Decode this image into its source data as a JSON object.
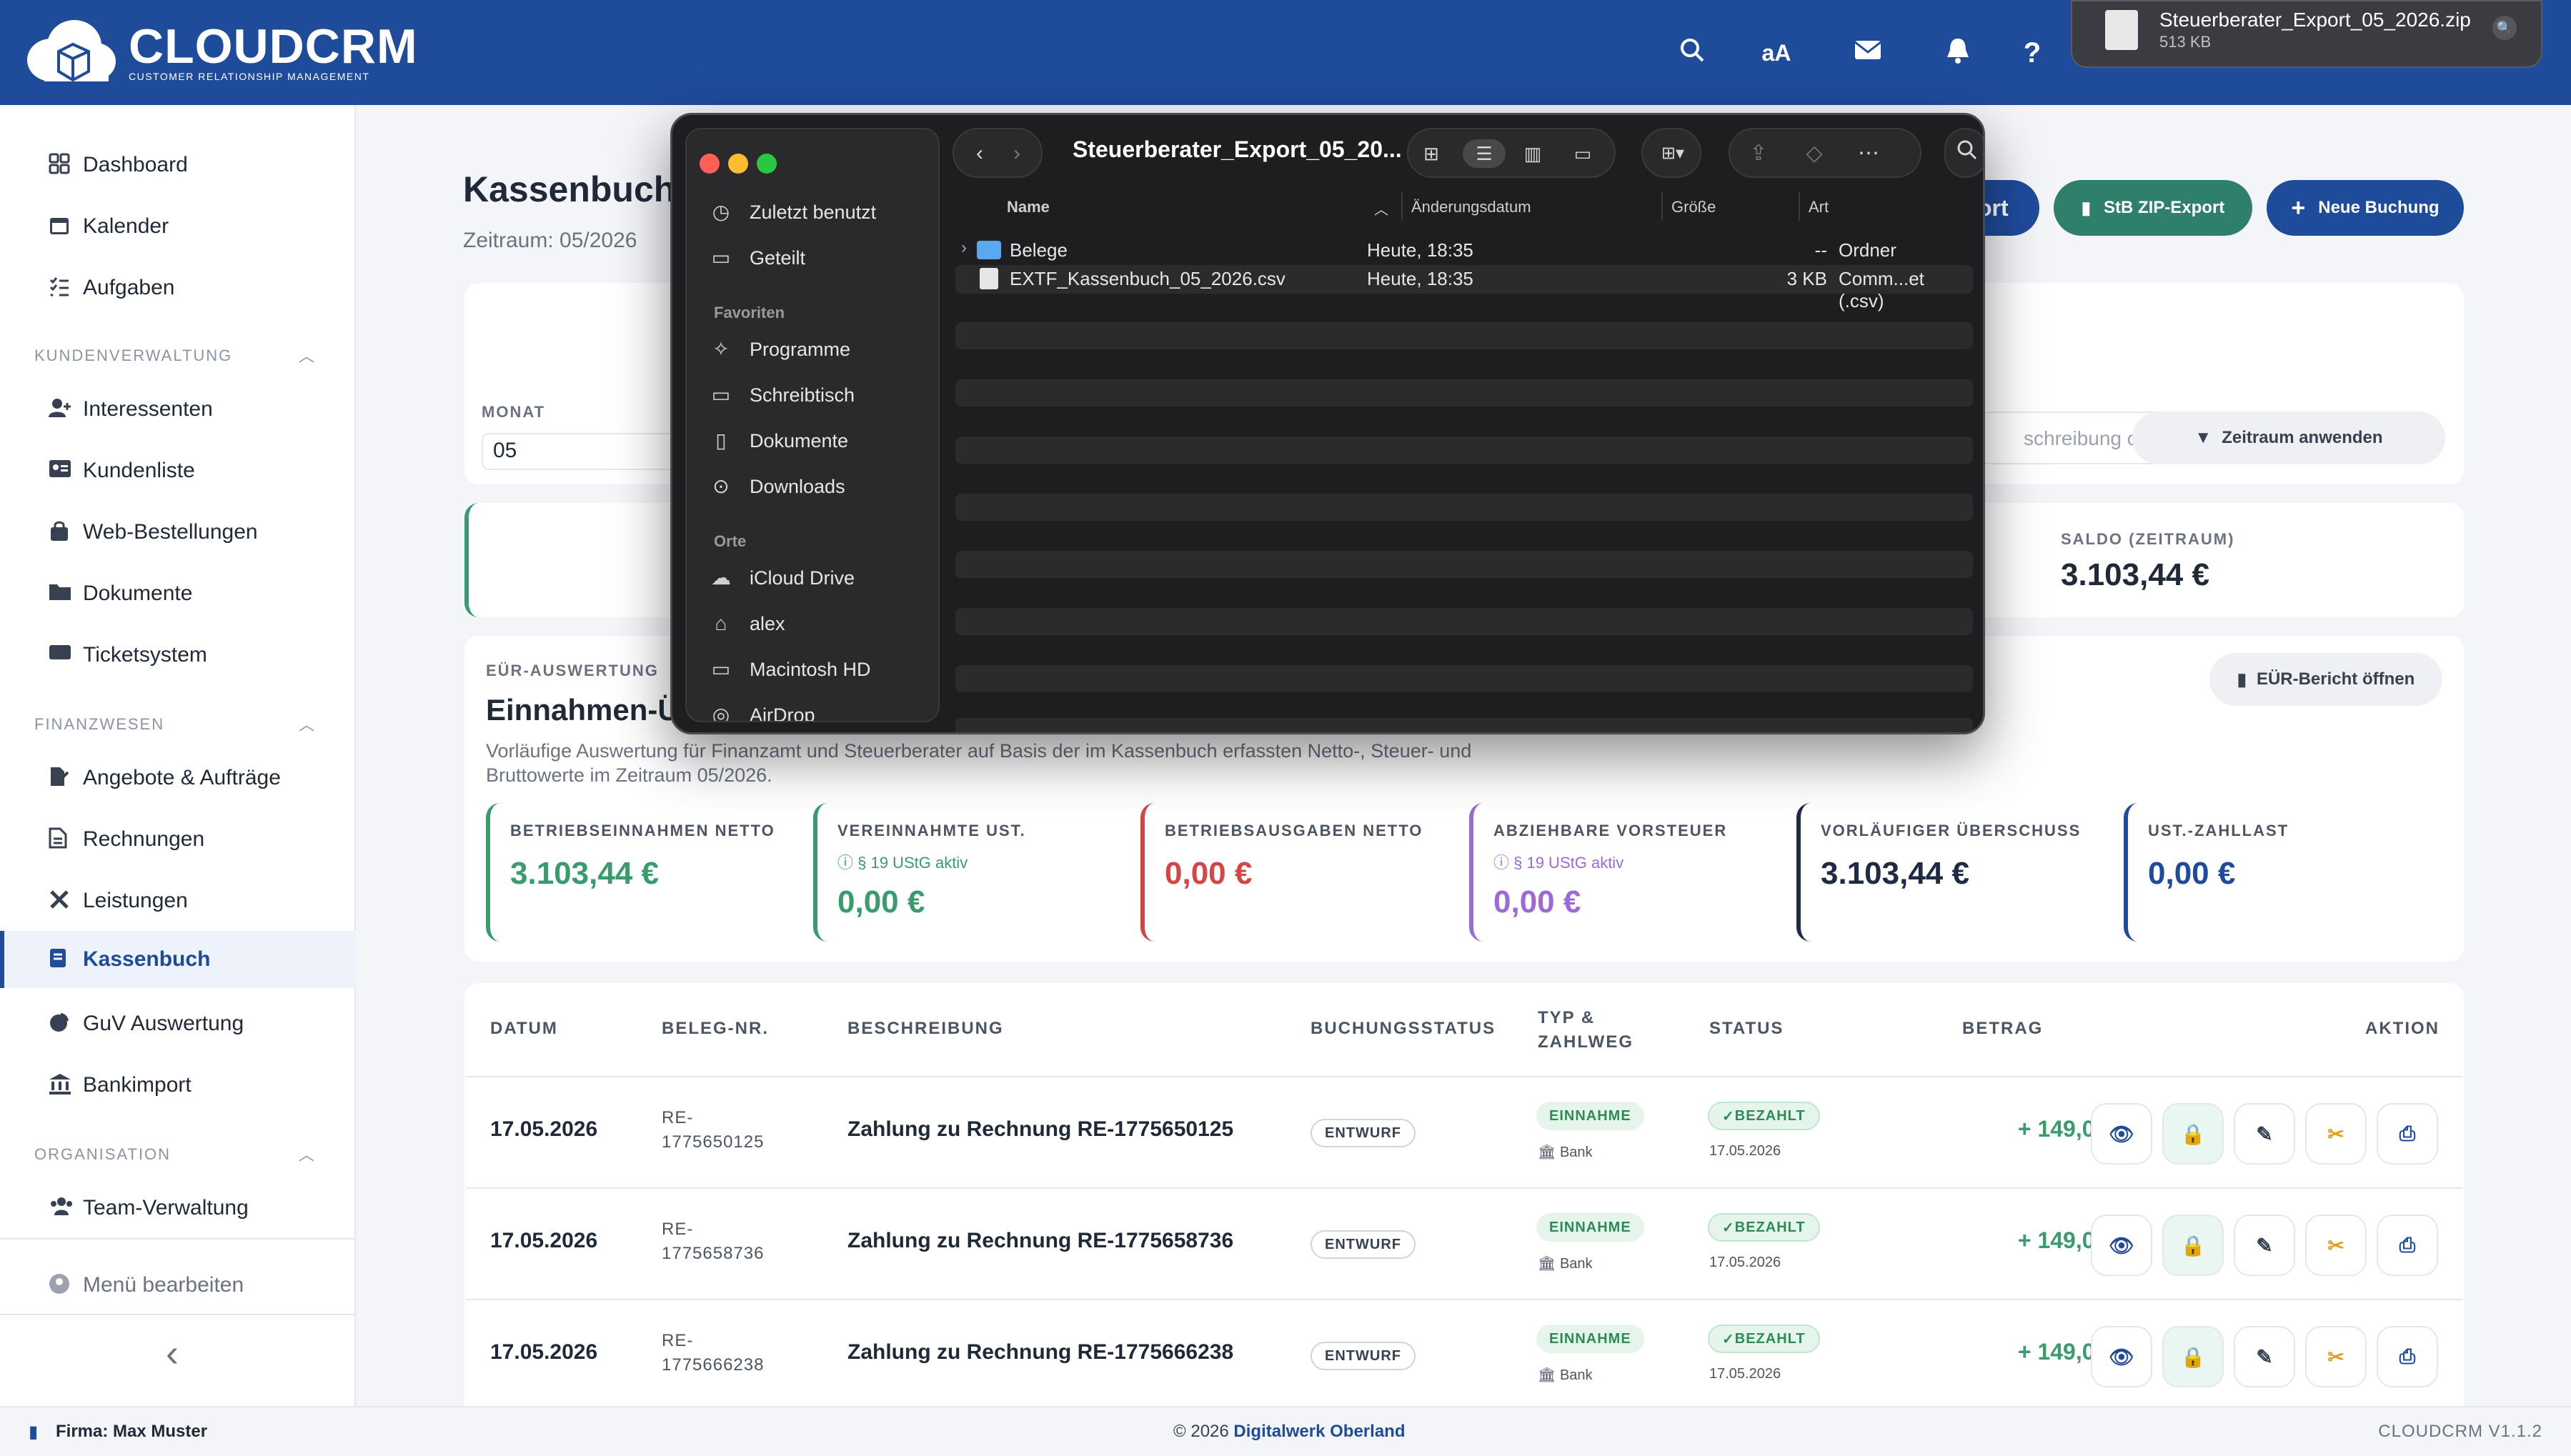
{
  "app": {
    "logo_title": "CLOUDCRM",
    "logo_sub": "CUSTOMER RELATIONSHIP MANAGEMENT",
    "font_toggle": "aA",
    "help": "?"
  },
  "download": {
    "file_name": "Steuerberater_Export_05_2026.zip",
    "file_size": "513 KB"
  },
  "sidebar": {
    "items_top": [
      {
        "label": "Dashboard",
        "icon": "dashboard-icon"
      },
      {
        "label": "Kalender",
        "icon": "calendar-icon"
      },
      {
        "label": "Aufgaben",
        "icon": "tasks-icon"
      }
    ],
    "section_kunden": "KUNDENVERWALTUNG",
    "items_kunden": [
      {
        "label": "Interessenten",
        "icon": "user-plus-icon"
      },
      {
        "label": "Kundenliste",
        "icon": "address-card-icon"
      },
      {
        "label": "Web-Bestellungen",
        "icon": "shopping-bag-icon"
      },
      {
        "label": "Dokumente",
        "icon": "folder-icon"
      },
      {
        "label": "Ticketsystem",
        "icon": "ticket-icon"
      }
    ],
    "section_finanz": "FINANZWESEN",
    "items_finanz": [
      {
        "label": "Angebote & Aufträge",
        "icon": "file-signature-icon"
      },
      {
        "label": "Rechnungen",
        "icon": "invoice-icon"
      },
      {
        "label": "Leistungen",
        "icon": "tools-icon"
      },
      {
        "label": "Kassenbuch",
        "icon": "book-icon"
      },
      {
        "label": "GuV Auswertung",
        "icon": "pie-chart-icon"
      },
      {
        "label": "Bankimport",
        "icon": "bank-icon"
      }
    ],
    "section_org": "ORGANISATION",
    "items_org": [
      {
        "label": "Team-Verwaltung",
        "icon": "users-icon"
      }
    ],
    "edit_menu": "Menü bearbeiten",
    "collapse": "‹"
  },
  "page": {
    "title": "Kassenbuch",
    "subtitle": "Zeitraum: 05/2026",
    "export_partial": "ort",
    "zip_export": "StB ZIP-Export",
    "new_entry": "Neue Buchung"
  },
  "filter": {
    "month_label": "MONAT",
    "month_value": "05",
    "search_partial": "schreibung o",
    "apply": "Zeitraum anwenden"
  },
  "saldo": {
    "label": "SALDO (ZEITRAUM)",
    "value": "3.103,44 €"
  },
  "euer": {
    "section": "EÜR-AUSWERTUNG",
    "title": "Einnahmen-Ü",
    "open_report": "EÜR-Bericht öffnen",
    "description_1": "Vorläufige Auswertung für Finanzamt und Steuerberater auf Basis der im Kassenbuch erfassten Netto-, Steuer- und",
    "description_2": "Bruttowerte im Zeitraum 05/2026.",
    "kpis": [
      {
        "label": "BETRIEBSEINNAHMEN NETTO",
        "note": "",
        "value": "3.103,44 €",
        "color": "#3a9b6e"
      },
      {
        "label": "VEREINNAHMTE UST.",
        "note": "§ 19 UStG aktiv",
        "value": "0,00 €",
        "color": "#3a9b6e"
      },
      {
        "label": "BETRIEBSAUSGABEN NETTO",
        "note": "",
        "value": "0,00 €",
        "color": "#d64545"
      },
      {
        "label": "ABZIEHBARE VORSTEUER",
        "note": "§ 19 UStG aktiv",
        "value": "0,00 €",
        "color": "#9b6ad6"
      },
      {
        "label": "VORLÄUFIGER ÜBERSCHUSS",
        "note": "",
        "value": "3.103,44 €",
        "color": "#1f2a44"
      },
      {
        "label": "UST.-ZAHLLAST",
        "note": "",
        "value": "0,00 €",
        "color": "#1f4b9b"
      }
    ]
  },
  "table": {
    "headers": {
      "datum": "DATUM",
      "beleg": "BELEG-NR.",
      "beschreibung": "BESCHREIBUNG",
      "buchungsstatus": "BUCHUNGSSTATUS",
      "typ_1": "TYP &",
      "typ_2": "ZAHLWEG",
      "status": "STATUS",
      "betrag": "BETRAG",
      "aktion": "AKTION"
    },
    "rows": [
      {
        "date": "17.05.2026",
        "beleg_1": "RE-",
        "beleg_2": "1775650125",
        "desc": "Zahlung zu Rechnung RE-1775650125",
        "buchung": "ENTWURF",
        "typ": "EINNAHME",
        "zahlweg": "Bank",
        "status": "BEZAHLT",
        "status_date": "17.05.2026",
        "amount": "+ 149,00 €"
      },
      {
        "date": "17.05.2026",
        "beleg_1": "RE-",
        "beleg_2": "1775658736",
        "desc": "Zahlung zu Rechnung RE-1775658736",
        "buchung": "ENTWURF",
        "typ": "EINNAHME",
        "zahlweg": "Bank",
        "status": "BEZAHLT",
        "status_date": "17.05.2026",
        "amount": "+ 149,00 €"
      },
      {
        "date": "17.05.2026",
        "beleg_1": "RE-",
        "beleg_2": "1775666238",
        "desc": "Zahlung zu Rechnung RE-1775666238",
        "buchung": "ENTWURF",
        "typ": "EINNAHME",
        "zahlweg": "Bank",
        "status": "BEZAHLT",
        "status_date": "17.05.2026",
        "amount": "+ 149,00 €"
      }
    ]
  },
  "footer": {
    "company": "Firma: Max Muster",
    "copyright": "© 2026",
    "copyright_link": "Digitalwerk Oberland",
    "version": "CLOUDCRM V1.1.2"
  },
  "finder": {
    "title": "Steuerberater_Export_05_20...",
    "sidebar_top": [
      {
        "label": "Zuletzt benutzt",
        "icon": "clock-icon"
      },
      {
        "label": "Geteilt",
        "icon": "shared-folder-icon"
      }
    ],
    "section_fav": "Favoriten",
    "favorites": [
      {
        "label": "Programme",
        "icon": "apps-icon"
      },
      {
        "label": "Schreibtisch",
        "icon": "desktop-icon"
      },
      {
        "label": "Dokumente",
        "icon": "document-icon"
      },
      {
        "label": "Downloads",
        "icon": "download-icon"
      }
    ],
    "section_places": "Orte",
    "places": [
      {
        "label": "iCloud Drive",
        "icon": "cloud-icon"
      },
      {
        "label": "alex",
        "icon": "home-icon"
      },
      {
        "label": "Macintosh HD",
        "icon": "disk-icon"
      },
      {
        "label": "AirDrop",
        "icon": "airdrop-icon"
      }
    ],
    "columns": {
      "name": "Name",
      "date": "Änderungsdatum",
      "size": "Größe",
      "kind": "Art"
    },
    "files": [
      {
        "name": "Belege",
        "date": "Heute, 18:35",
        "size": "--",
        "kind": "Ordner"
      },
      {
        "name": "EXTF_Kassenbuch_05_2026.csv",
        "date": "Heute, 18:35",
        "size": "3 KB",
        "kind": "Comm...et (.csv)"
      }
    ]
  }
}
